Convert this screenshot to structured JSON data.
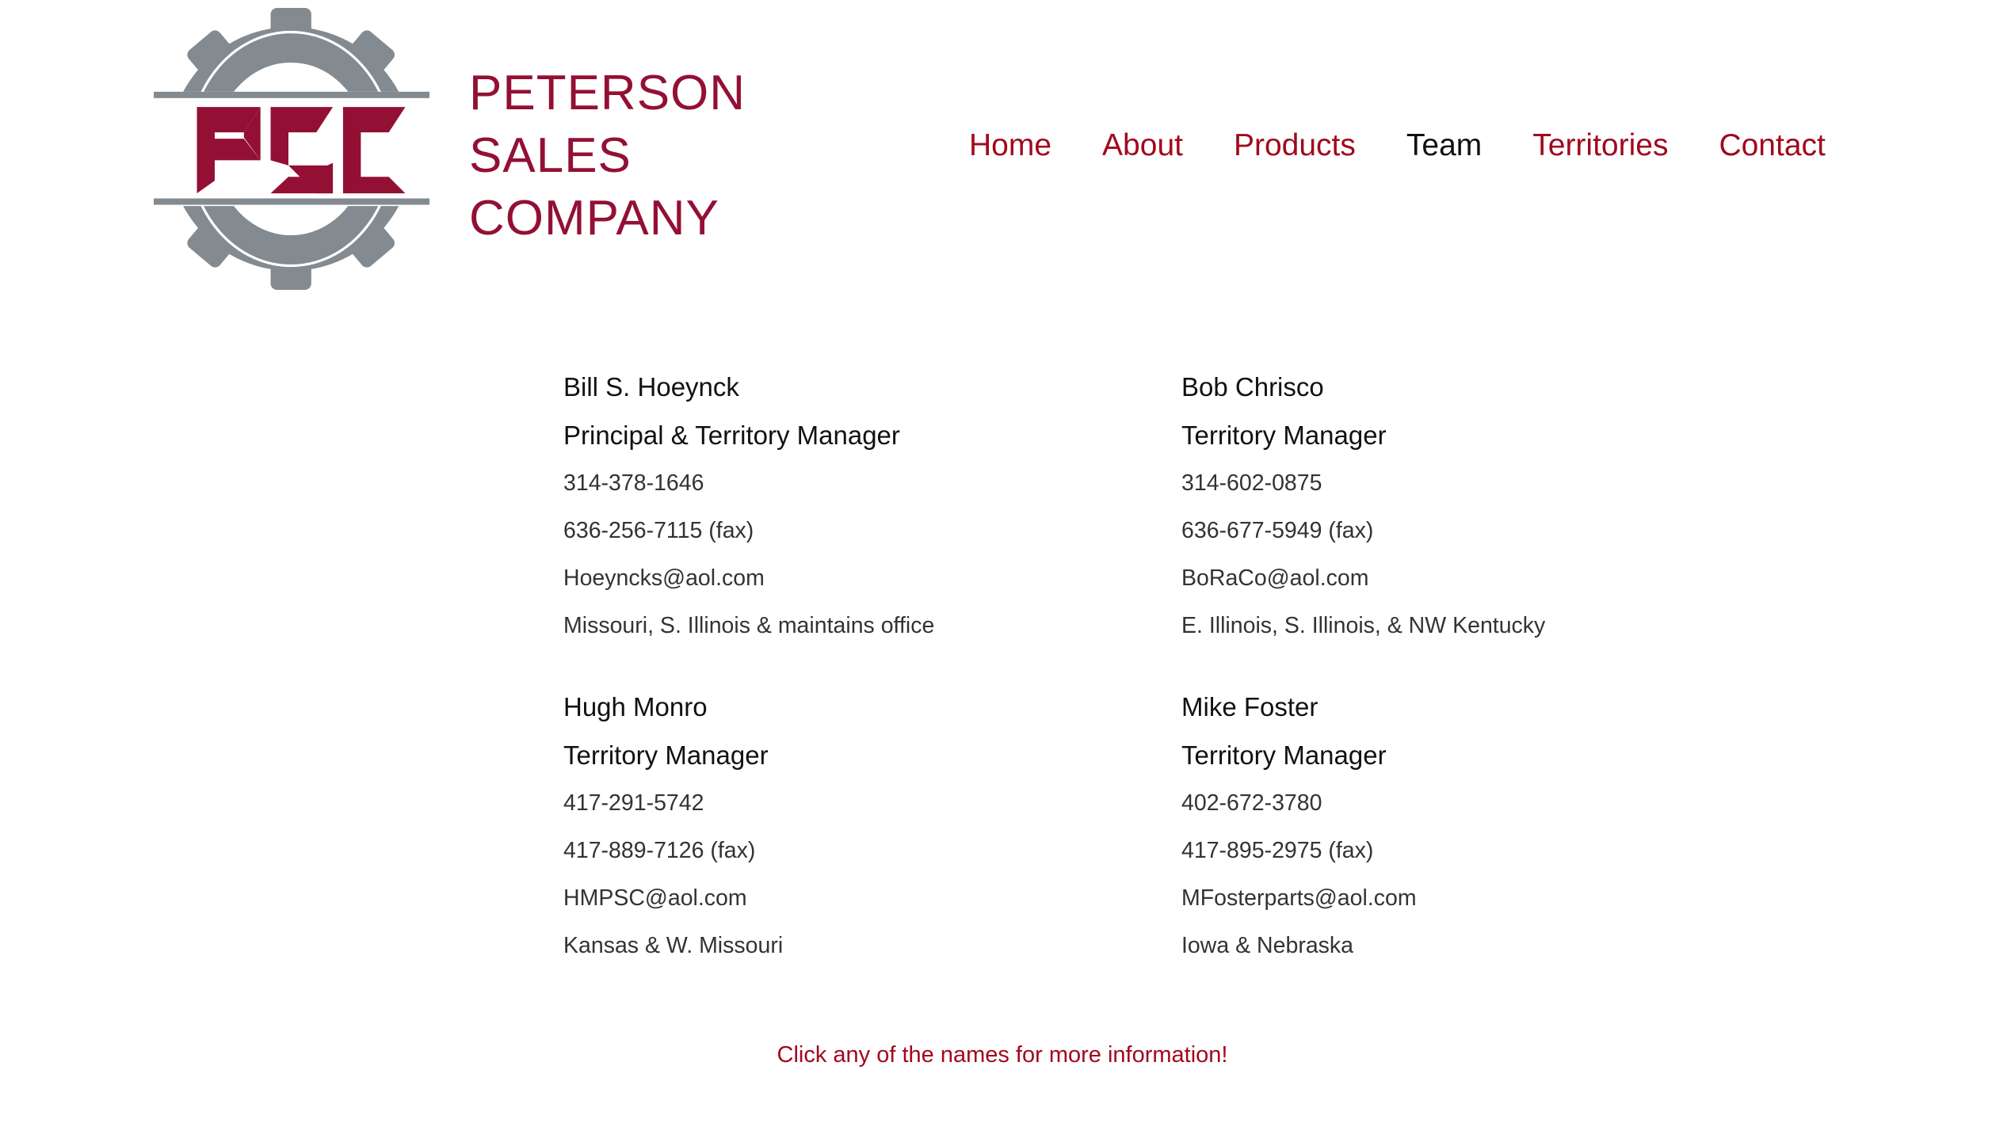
{
  "logo": {
    "monogram": "PSC",
    "lines": [
      "PETERSON",
      "SALES",
      "COMPANY"
    ]
  },
  "nav": {
    "items": [
      "Home",
      "About",
      "Products",
      "Team",
      "Territories",
      "Contact"
    ],
    "active": "Team"
  },
  "team": [
    {
      "name": "Bill S. Hoeynck",
      "role": "Principal & Territory Manager",
      "phone": "314-378-1646",
      "fax": "636-256-7115 (fax)",
      "email": "Hoeyncks@aol.com",
      "territory": "Missouri, S. Illinois & maintains office"
    },
    {
      "name": "Bob Chrisco",
      "role": "Territory Manager",
      "phone": "314-602-0875",
      "fax": "636-677-5949 (fax)",
      "email": "BoRaCo@aol.com",
      "territory": "E. Illinois, S. Illinois, & NW Kentucky"
    },
    {
      "name": "Hugh Monro",
      "role": "Territory Manager",
      "phone": "417-291-5742",
      "fax": "417-889-7126 (fax)",
      "email": "HMPSC@aol.com",
      "territory": "Kansas & W. Missouri"
    },
    {
      "name": "Mike Foster",
      "role": "Territory Manager",
      "phone": "402-672-3780",
      "fax": "417-895-2975 (fax)",
      "email": "MFosterparts@aol.com",
      "territory": "Iowa & Nebraska"
    }
  ],
  "footer": {
    "note": "Click any of the names for more information!"
  },
  "colors": {
    "brand_red": "#931034",
    "link_red": "#a1091d",
    "gear_gray": "#838b91"
  }
}
